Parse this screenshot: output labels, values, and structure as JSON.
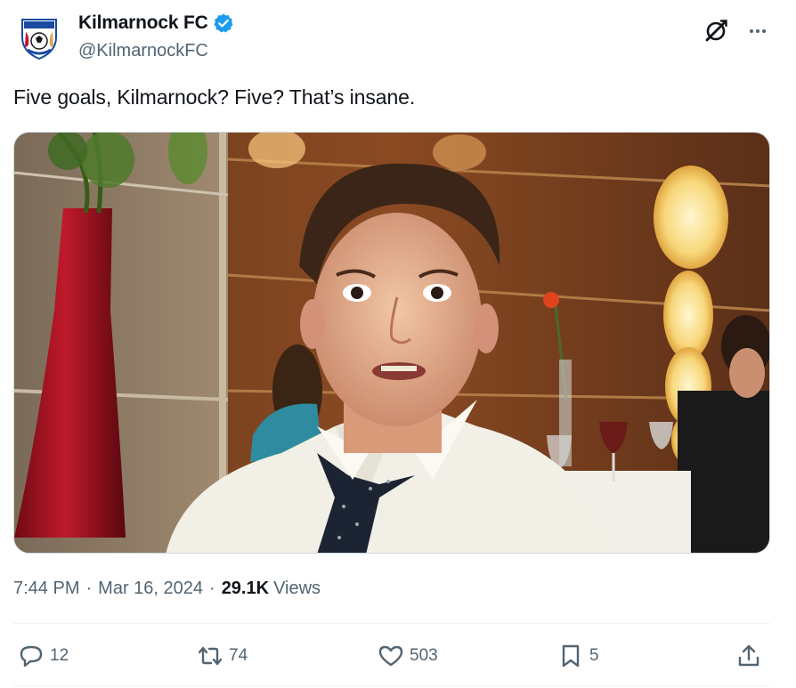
{
  "author": {
    "display_name": "Kilmarnock FC",
    "handle": "@KilmarnockFC",
    "verified": true,
    "verified_color": "#1d9bf0",
    "avatar_icon": "club-crest-icon"
  },
  "header_icons": {
    "grok": "grok-icon",
    "more": "more-options-icon"
  },
  "tweet": {
    "text": "Five goals, Kilmarnock? Five? That’s insane.",
    "media_description_icon": "video-still-image"
  },
  "meta": {
    "time": "7:44 PM",
    "separator": "·",
    "date": "Mar 16, 2024",
    "views_count": "29.1K",
    "views_label": "Views"
  },
  "actions": {
    "replies": "12",
    "reposts": "74",
    "likes": "503",
    "bookmarks": "5"
  },
  "colors": {
    "text_primary": "#0f1419",
    "text_secondary": "#536471",
    "divider": "#eff3f4"
  }
}
